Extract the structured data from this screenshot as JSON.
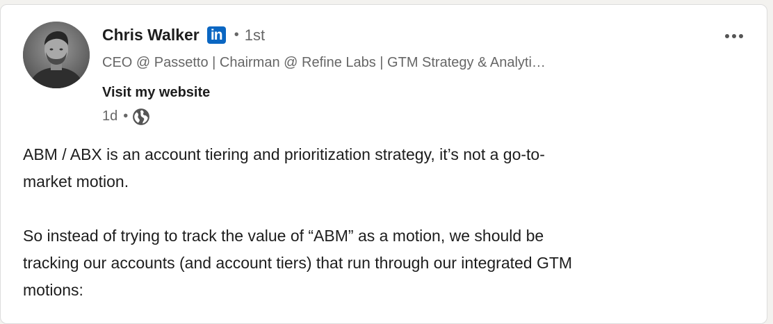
{
  "author": {
    "name": "Chris Walker",
    "badge": "in",
    "separator": "•",
    "connection_degree": "1st",
    "headline": "CEO @ Passetto | Chairman @ Refine Labs | GTM Strategy & Analyti…",
    "website_label": "Visit my website"
  },
  "meta": {
    "time": "1d",
    "separator": "•",
    "visibility_icon": "globe-icon"
  },
  "post": {
    "lines": [
      "ABM / ABX is an account tiering and prioritization strategy, it’s not a go-to-",
      "market motion.",
      "So instead of trying to track the value of “ABM” as a motion, we should be",
      "tracking our accounts (and account tiers) that run through our integrated GTM",
      "motions:"
    ]
  },
  "colors": {
    "linkedin_blue": "#0a66c2",
    "text_primary": "#1d1d1d",
    "text_secondary": "#666666"
  },
  "icons": {
    "more": "ellipsis-icon",
    "linkedin": "linkedin-icon",
    "avatar": "avatar"
  }
}
